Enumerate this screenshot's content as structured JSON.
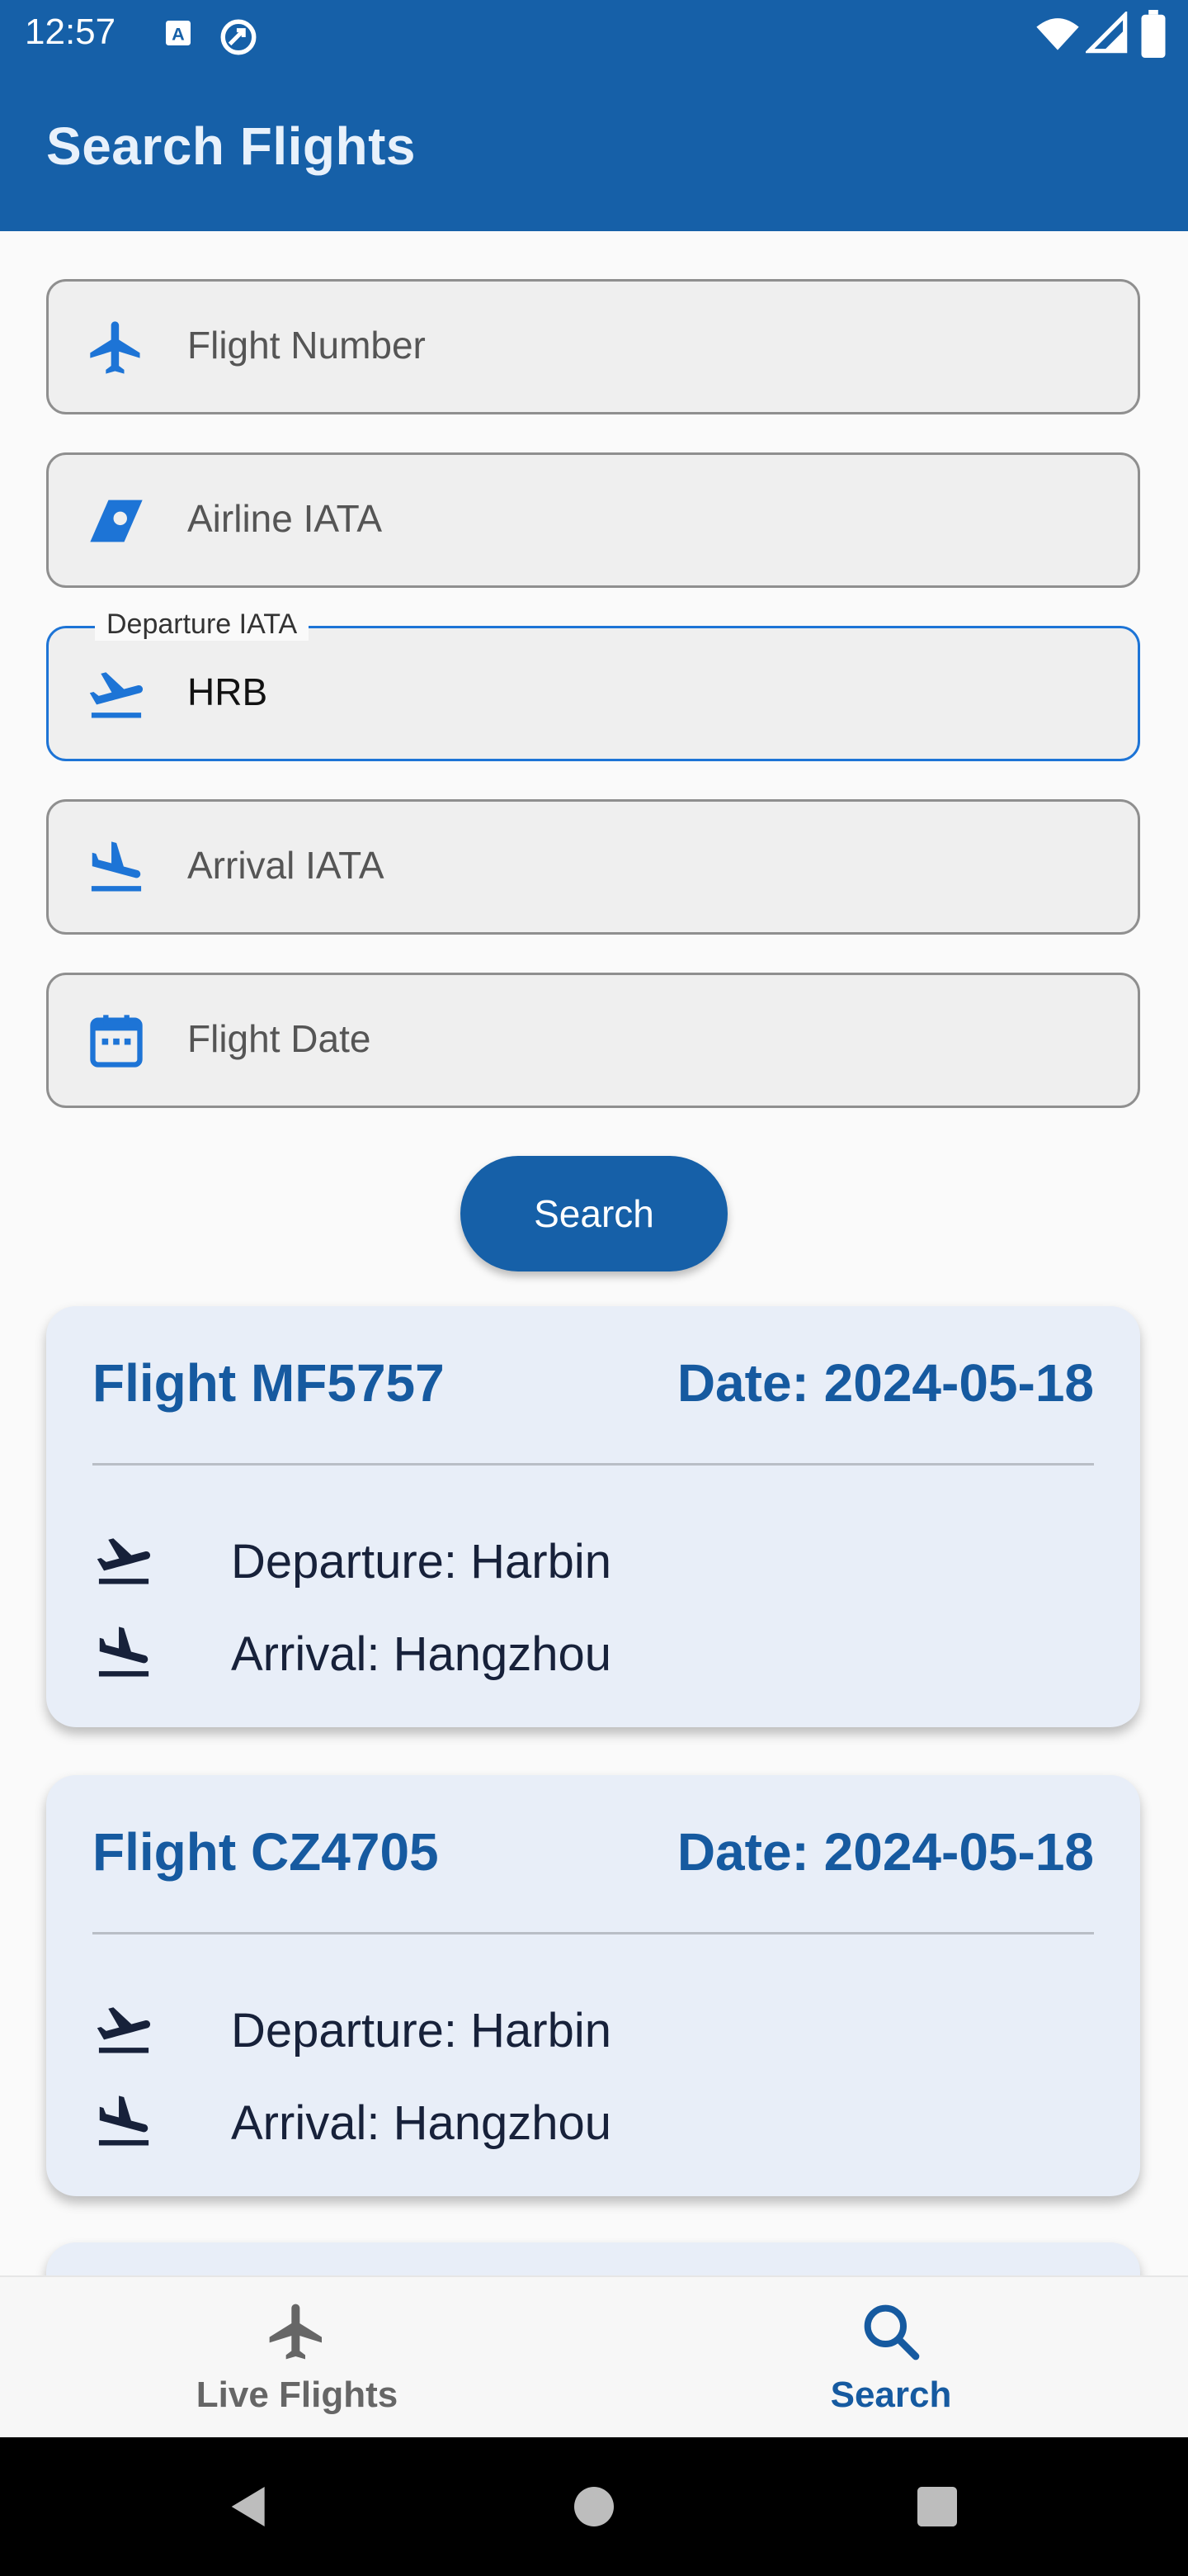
{
  "status_bar": {
    "time": "12:57",
    "icons": [
      "a-notification-icon",
      "sync-icon",
      "wifi-icon",
      "signal-icon",
      "battery-icon"
    ]
  },
  "app_bar": {
    "title": "Search Flights"
  },
  "form": {
    "fields": [
      {
        "name": "flight-number",
        "placeholder": "Flight Number",
        "value": "",
        "icon": "plane-icon"
      },
      {
        "name": "airline-iata",
        "placeholder": "Airline IATA",
        "value": "",
        "icon": "airline-tail-icon"
      },
      {
        "name": "departure-iata",
        "label": "Departure IATA",
        "value": "HRB",
        "icon": "flight-takeoff-icon"
      },
      {
        "name": "arrival-iata",
        "placeholder": "Arrival IATA",
        "value": "",
        "icon": "flight-land-icon"
      },
      {
        "name": "flight-date",
        "placeholder": "Flight Date",
        "value": "",
        "icon": "calendar-icon"
      }
    ],
    "search_label": "Search"
  },
  "results": [
    {
      "flight": "Flight MF5757",
      "date": "Date: 2024-05-18",
      "departure": "Departure: Harbin",
      "arrival": "Arrival: Hangzhou"
    },
    {
      "flight": "Flight CZ4705",
      "date": "Date: 2024-05-18",
      "departure": "Departure: Harbin",
      "arrival": "Arrival: Hangzhou"
    }
  ],
  "bottom_nav": {
    "items": [
      {
        "label": "Live Flights",
        "icon": "plane-icon",
        "active": false
      },
      {
        "label": "Search",
        "icon": "search-icon",
        "active": true
      }
    ]
  },
  "colors": {
    "primary": "#1660a8",
    "field_focus": "#1d74d6",
    "card_bg": "#e8eef8",
    "card_text": "#165aa0"
  }
}
